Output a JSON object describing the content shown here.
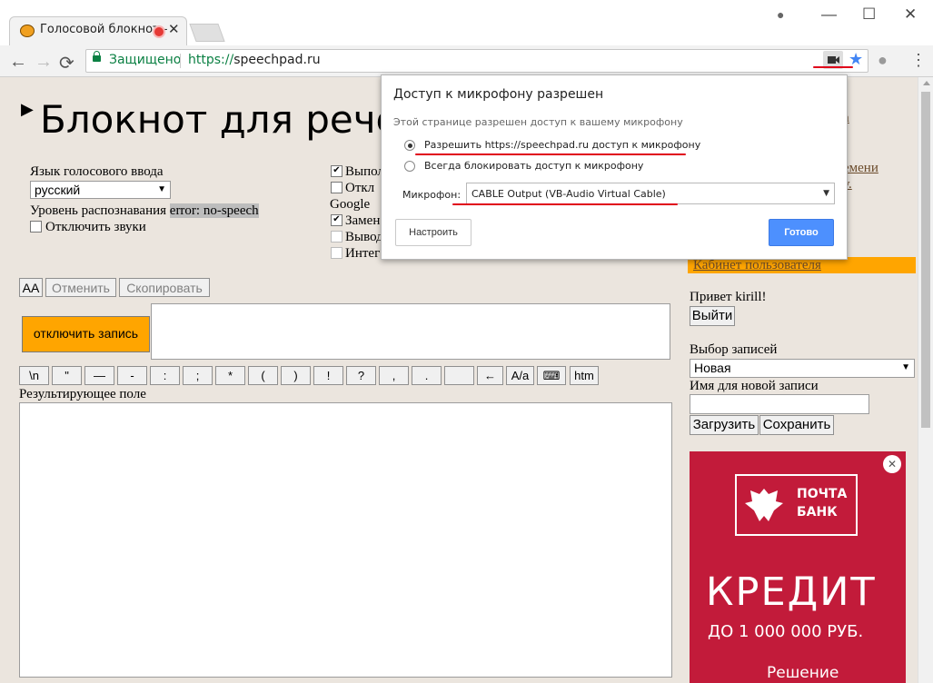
{
  "browser": {
    "tab_title": "Голосовой блокнот -",
    "tab_close": "✕",
    "secure_label": "Защищено",
    "url_scheme": "https://",
    "url_host": "speechpad.ru",
    "nav": {
      "back": "←",
      "forward": "→",
      "reload": "⟳"
    },
    "window": {
      "minimize": "—",
      "maximize": "☐",
      "close": "✕",
      "account": "●"
    },
    "star": "★",
    "menu": "⋮"
  },
  "page": {
    "title": "Блокнот для речевог",
    "lang_label": "Язык голосового ввода",
    "lang_value": "русский",
    "recog_label": "Уровень распознавания",
    "recog_value": "error: no-speech",
    "sound_off": "Отключить звуки",
    "opt1": "Выпол",
    "opt2": "Откл",
    "google_label": "Google",
    "opt3": "Замен",
    "opt4": "Вывод",
    "opt5": "Интег",
    "opt5_tail": "...",
    "btn_aa": "AA",
    "btn_undo": "Отменить",
    "btn_copy": "Скопировать",
    "btn_record": "отключить запись",
    "symbols": [
      "\\n",
      "\"",
      "—",
      "-",
      ":",
      ";",
      "*",
      "(",
      ")",
      "!",
      "?",
      ",",
      ".",
      "",
      "←",
      "A/a",
      "⌨",
      "htm"
    ],
    "result_label": "Результирующее поле"
  },
  "sidebar": {
    "frag1": "а",
    "frag2": "емени",
    "frag3": "у.",
    "cabinet_link": "Кабинет пользователя",
    "greeting": "Привет kirill!",
    "logout": "Выйти",
    "records_label": "Выбор записей",
    "records_value": "Новая",
    "newname_label": "Имя для новой записи",
    "load": "Загрузить",
    "save": "Сохранить",
    "ad": {
      "brand_line1": "ПОЧТА",
      "brand_line2": "БАНК",
      "headline": "КРЕДИТ",
      "amount": "ДО 1 000 000 РУБ.",
      "footer": "Решение",
      "close": "✕"
    }
  },
  "popup": {
    "title": "Доступ к микрофону разрешен",
    "subtitle": "Этой странице разрешен доступ к вашему микрофону",
    "option_allow": "Разрешить https://speechpad.ru доступ к микрофону",
    "option_block": "Всегда блокировать доступ к микрофону",
    "mic_label": "Микрофон:",
    "mic_value": "CABLE Output (VB-Audio Virtual Cable)",
    "btn_configure": "Настроить",
    "btn_done": "Готово",
    "allow_selected": true
  },
  "colors": {
    "accent_orange": "#ffa500",
    "done_blue": "#4d90fe",
    "annotation_red": "#e0001a",
    "page_bg": "#ebe5de"
  }
}
